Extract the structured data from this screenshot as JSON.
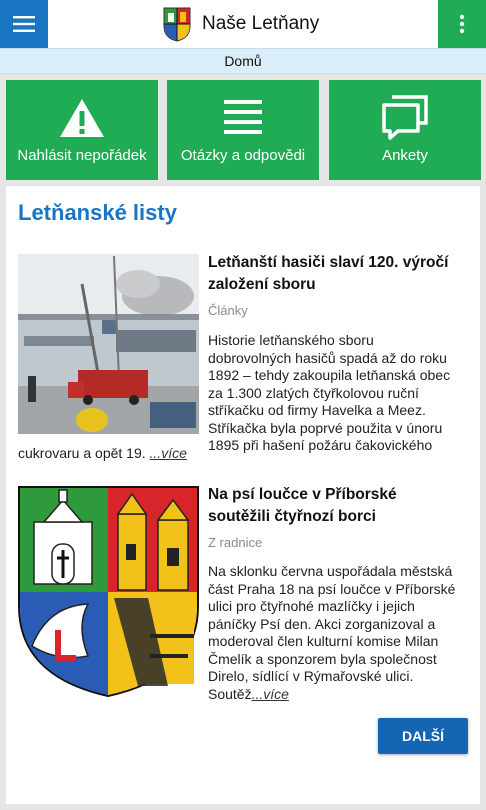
{
  "app": {
    "title": "Naše Letňany"
  },
  "breadcrumb": "Domů",
  "tiles": [
    {
      "label": "Nahlásit nepořádek",
      "icon": "warning-icon"
    },
    {
      "label": "Otázky a odpovědi",
      "icon": "list-icon"
    },
    {
      "label": "Ankety",
      "icon": "chat-icon"
    }
  ],
  "section": {
    "title": "Letňanské listy"
  },
  "articles": [
    {
      "title_lines": [
        "Letňanští hasiči slaví 120. výročí",
        "založení sboru"
      ],
      "category": "Články",
      "text_lines": [
        "Historie letňanského sboru",
        "dobrovolných hasičů spadá až do roku",
        "1892 – tehdy zakoupila letňanská obec",
        "za 1.300 zlatých čtyřkolovou ruční",
        "stříkačku od firmy Havelka a Meez.",
        "Stříkačka byla poprvé použita v únoru",
        "1895 při hašení požáru čakovického"
      ],
      "text_tail": "cukrovaru a opět 19.",
      "more": "...více"
    },
    {
      "title_lines": [
        "Na psí loučce v Příborské",
        "soutěžili čtyřnozí borci"
      ],
      "category": "Z radnice",
      "text_lines": [
        "Na sklonku června uspořádala městská",
        "část Praha 18 na psí loučce v Příborské",
        "ulici pro čtyřnohé mazlíčky i jejich",
        "páníčky Psí den. Akci zorganizoval a",
        "moderoval člen kulturní komise Milan",
        "Čmelík a sponzorem byla společnost",
        "Direlo, sídlící v Rýmařovské ulici."
      ],
      "text_tail": "Soutěž",
      "more": "...více"
    }
  ],
  "pager": {
    "next": "DALŠÍ"
  },
  "colors": {
    "blue": "#1976c2",
    "green": "#1fac55",
    "breadcrumb_bg": "#d9eef8"
  }
}
